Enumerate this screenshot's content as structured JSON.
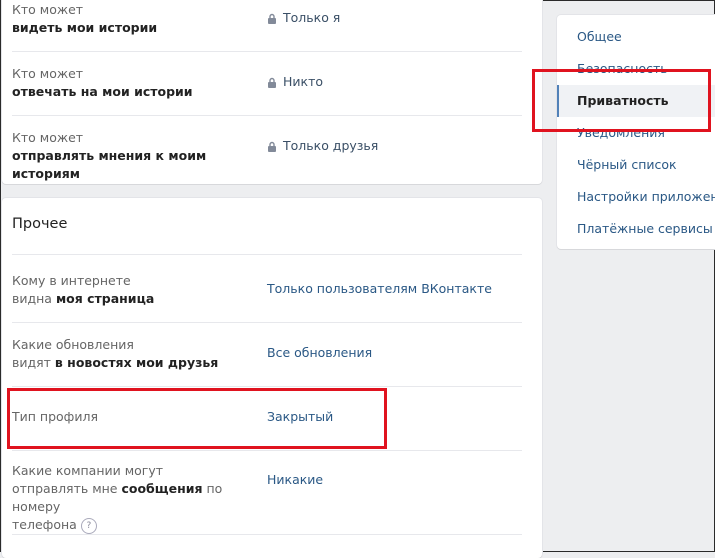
{
  "stories": {
    "rows": [
      {
        "label_pre": "Кто может",
        "label_bold": "видеть мои истории",
        "value": "Только я"
      },
      {
        "label_pre": "Кто может",
        "label_bold": "отвечать на мои истории",
        "value": "Никто"
      },
      {
        "label_pre": "Кто может",
        "label_bold": "отправлять мнения к моим историям",
        "value": "Только друзья"
      }
    ]
  },
  "other": {
    "title": "Прочее",
    "rows": [
      {
        "label_pre": "Кому в интернете",
        "label_mid": "видна ",
        "label_bold": "моя страница",
        "value": "Только пользователям ВКонтакте"
      },
      {
        "label_pre": "Какие обновления",
        "label_mid": "видят ",
        "label_bold": "в новостях мои друзья",
        "value": "Все обновления"
      },
      {
        "label": "Тип профиля",
        "value": "Закрытый"
      },
      {
        "label_pre": "Какие компании могут",
        "label_mid": "отправлять мне ",
        "label_bold": "сообщения",
        "label_post": " по номеру",
        "label_last": "телефона",
        "help": "?",
        "value": "Никакие"
      }
    ]
  },
  "nav": {
    "items": [
      {
        "label": "Общее"
      },
      {
        "label": "Безопасность"
      },
      {
        "label": "Приватность",
        "active": true
      },
      {
        "label": "Уведомления"
      },
      {
        "label": "Чёрный список"
      },
      {
        "label": "Настройки приложений"
      },
      {
        "label": "Платёжные сервисы"
      }
    ]
  },
  "icons": {
    "lock": "lock-icon",
    "help": "help-icon"
  },
  "colors": {
    "link": "#2a5885",
    "highlight": "#e0131f",
    "active_border": "#5181b8"
  }
}
